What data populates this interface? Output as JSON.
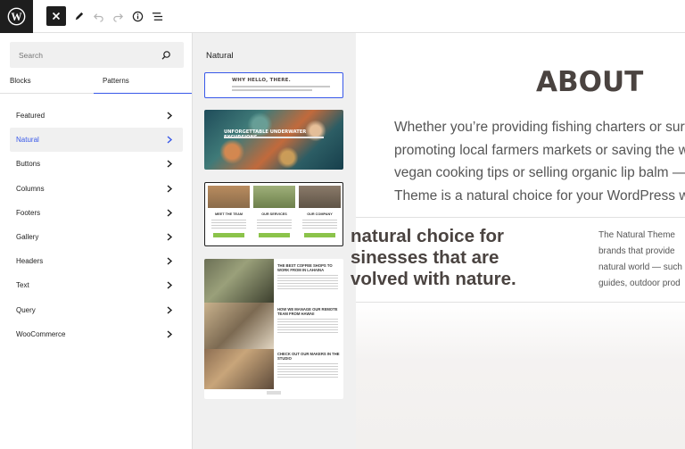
{
  "toolbar": {
    "close_icon": "close-icon",
    "edit_icon": "pencil-icon",
    "undo_icon": "undo-icon",
    "redo_icon": "redo-icon",
    "info_icon": "info-icon",
    "list_view_icon": "list-view-icon"
  },
  "inserter": {
    "search": {
      "placeholder": "Search"
    },
    "tabs": [
      {
        "label": "Blocks"
      },
      {
        "label": "Patterns"
      }
    ],
    "categories": [
      {
        "label": "Featured"
      },
      {
        "label": "Natural"
      },
      {
        "label": "Buttons"
      },
      {
        "label": "Columns"
      },
      {
        "label": "Footers"
      },
      {
        "label": "Gallery"
      },
      {
        "label": "Headers"
      },
      {
        "label": "Text"
      },
      {
        "label": "Query"
      },
      {
        "label": "WooCommerce"
      }
    ],
    "active_category": "Natural"
  },
  "patterns": {
    "title": "Natural",
    "card1": {
      "heading": "WHY HELLO, THERE."
    },
    "card2": {
      "heading": "UNFORGETTABLE UNDERWATER EXCURSIONS"
    },
    "card3": {
      "cols": [
        "MEET THE TEAM",
        "OUR SERVICES",
        "OUR COMPANY"
      ]
    },
    "card4": {
      "items": [
        "THE BEST COFFEE SHOPS TO WORK FROM IN LAHAINA",
        "HOW WE MANAGE OUR REMOTE TEAM FROM HAWAII",
        "CHECK OUT OUR MAKERS IN THE STUDIO"
      ]
    }
  },
  "canvas": {
    "heading": "ABOUT",
    "intro_lines": [
      "Whether you’re providing fishing charters or surf",
      "promoting local farmers markets or saving the w",
      "vegan cooking tips or selling organic lip balm —",
      "Theme is a natural choice for your WordPress w"
    ],
    "big_lines": [
      "natural choice for",
      "sinesses that are",
      "volved with nature."
    ],
    "right_lines": [
      "The Natural Theme",
      "brands that provide",
      "natural world — such",
      "guides, outdoor prod"
    ]
  },
  "colors": {
    "accent": "#3858e9",
    "dark": "#1e1e1e",
    "heading": "#4a4340"
  }
}
